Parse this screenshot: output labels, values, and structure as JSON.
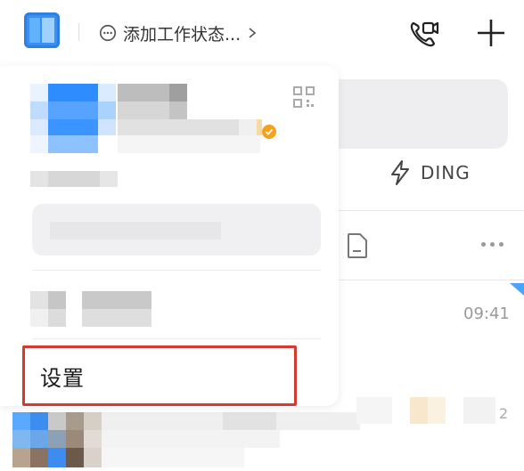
{
  "header": {
    "status_label": "添加工作状态...",
    "status_icon": "chat-bubble-icon",
    "video_call_icon": "video-call-icon",
    "add_icon": "plus-icon"
  },
  "toolbar": {
    "ding_label": "DING"
  },
  "chat": {
    "time": "09:41",
    "badge": "2"
  },
  "drawer": {
    "settings_label": "设置",
    "highlight_color": "#d43a2f"
  },
  "colors": {
    "accent": "#3a8ff5",
    "verified": "#f5a11c"
  }
}
